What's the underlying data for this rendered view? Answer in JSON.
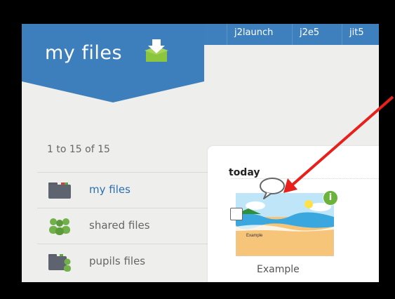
{
  "header": {
    "title": "my files",
    "nav_tabs": [
      {
        "label": "j2launch"
      },
      {
        "label": "j2e5"
      },
      {
        "label": "jit5"
      }
    ]
  },
  "sidebar": {
    "count_text": "1 to 15 of 15",
    "items": [
      {
        "label": "my files",
        "icon": "folder-icon",
        "active": true
      },
      {
        "label": "shared files",
        "icon": "people-icon",
        "active": false
      },
      {
        "label": "pupils files",
        "icon": "pupil-folder-icon",
        "active": false
      }
    ]
  },
  "main": {
    "section_title": "today",
    "files": [
      {
        "name": "Example",
        "thumb_text": "Example",
        "icon": "beach-thumbnail"
      }
    ]
  },
  "colors": {
    "accent": "#3d7fbc",
    "active_link": "#2b6fae",
    "info_badge": "#6cb33e",
    "annotation_arrow": "#e8201c"
  }
}
